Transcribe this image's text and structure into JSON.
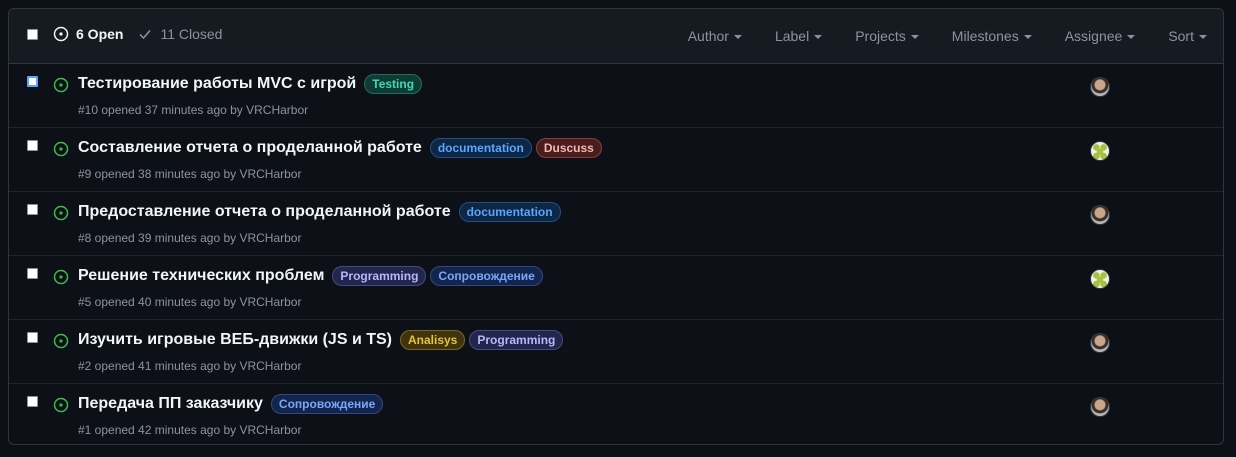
{
  "header": {
    "open_label": "6 Open",
    "closed_label": "11 Closed",
    "filters": [
      "Author",
      "Label",
      "Projects",
      "Milestones",
      "Assignee",
      "Sort"
    ]
  },
  "colors": {
    "open_icon": "#3fb950",
    "checkbox_focus": "#58a6ff"
  },
  "issues": [
    {
      "title": "Тестирование работы MVC с игрой",
      "meta": "#10 opened 37 minutes ago by VRCHarbor",
      "labels": [
        {
          "text": "Testing",
          "fg": "#3ddbb4",
          "bg": "#0e3b33",
          "border": "#1f6f5f"
        }
      ],
      "avatar": "photo"
    },
    {
      "title": "Составление отчета о проделанной работе",
      "meta": "#9 opened 38 minutes ago by VRCHarbor",
      "labels": [
        {
          "text": "documentation",
          "fg": "#58a6ff",
          "bg": "#0d2744",
          "border": "#1f4f86"
        },
        {
          "text": "Duscuss",
          "fg": "#f0b8b8",
          "bg": "#4a1d1d",
          "border": "#8a3b3b"
        }
      ],
      "avatar": "identicon"
    },
    {
      "title": "Предоставление отчета о проделанной работе",
      "meta": "#8 opened 39 minutes ago by VRCHarbor",
      "labels": [
        {
          "text": "documentation",
          "fg": "#58a6ff",
          "bg": "#0d2744",
          "border": "#1f4f86"
        }
      ],
      "avatar": "photo"
    },
    {
      "title": "Решение технических проблем",
      "meta": "#5 opened 40 minutes ago by VRCHarbor",
      "labels": [
        {
          "text": "Programming",
          "fg": "#b4b8ff",
          "bg": "#23264a",
          "border": "#454a8a"
        },
        {
          "text": "Сопровождение",
          "fg": "#79a6ff",
          "bg": "#13254a",
          "border": "#2c4a86"
        }
      ],
      "avatar": "identicon"
    },
    {
      "title": "Изучить игровые ВЕБ-движки (JS и TS)",
      "meta": "#2 opened 41 minutes ago by VRCHarbor",
      "labels": [
        {
          "text": "Analisys",
          "fg": "#e8c33a",
          "bg": "#3e3410",
          "border": "#7a6420"
        },
        {
          "text": "Programming",
          "fg": "#b4b8ff",
          "bg": "#23264a",
          "border": "#454a8a"
        }
      ],
      "avatar": "photo"
    },
    {
      "title": "Передача ПП заказчику",
      "meta": "#1 opened 42 minutes ago by VRCHarbor",
      "labels": [
        {
          "text": "Сопровождение",
          "fg": "#79a6ff",
          "bg": "#13254a",
          "border": "#2c4a86"
        }
      ],
      "avatar": "photo"
    }
  ]
}
